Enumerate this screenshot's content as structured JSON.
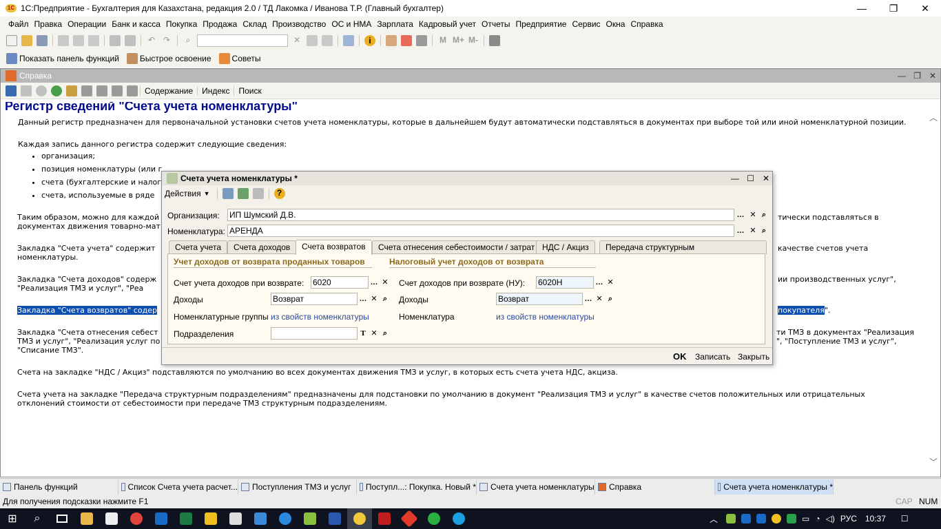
{
  "app": {
    "title": "1С:Предприятие - Бухгалтерия для Казахстана, редакция 2.0 / ТД Лакомка / Иванова Т.Р. (Главный бухгалтер)"
  },
  "menu": [
    "Файл",
    "Правка",
    "Операции",
    "Банк и касса",
    "Покупка",
    "Продажа",
    "Склад",
    "Производство",
    "ОС и НМА",
    "Зарплата",
    "Кадровый учет",
    "Отчеты",
    "Предприятие",
    "Сервис",
    "Окна",
    "Справка"
  ],
  "toolbar3": {
    "show_panel": "Показать панель функций",
    "quick": "Быстрое освоение",
    "tips": "Советы"
  },
  "help": {
    "window_title": "Справка",
    "links": [
      "Содержание",
      "Индекс",
      "Поиск"
    ],
    "heading": "Регистр сведений \"Счета учета номенклатуры\"",
    "p1": "Данный регистр предназначен для первоначальной установки счетов учета номенклатуры, которые в дальнейшем будут автоматически подставляться в документах при выборе той или иной номенклатурной позиции.",
    "p2": "Каждая запись данного регистра содержит следующие сведения:",
    "li": [
      "организация;",
      "позиция номенклатуры (или г",
      "счета (бухгалтерские и налог",
      "счета, используемые в ряде"
    ],
    "p3a": "Таким образом, можно для каждой",
    "p3b": "документах движения товарно-мат",
    "p3c": "тически подставляться в",
    "p4a": "Закладка \"Счета учета\" содержит",
    "p4b": "номенклатуры.",
    "p4c": "качестве счетов учета",
    "p5a": "Закладка \"Счета доходов\" содерж",
    "p5b": "\"Реализация ТМЗ и услуг\", \"Реа",
    "p5c": "ии производственных услуг\",",
    "p6a": "Закладка \"Счета возвратов\" содер",
    "p6b": "покупателя",
    "p6c": "\".",
    "p7a": "Закладка \"Счета отнесения себест",
    "p7b": "ТМЗ и услуг\", \"Реализация услуг по",
    "p7c": "\"Списание ТМЗ\".",
    "p7d": "ти ТМЗ в документах \"Реализация",
    "p7e": "\", \"Поступление ТМЗ и услуг\",",
    "p8": "Счета на закладке \"НДС / Акциз\" подставляются по умолчанию во всех документах движения ТМЗ и услуг, в которых есть счета учета НДС, акциза.",
    "p9a": "Счета учета на закладке \"Передача структурным подразделениям\" предназначены для подстановки по умолчанию в документ \"Реализация ТМЗ и услуг\" в качестве счетов положительных или отрицательных",
    "p9b": "отклонений стоимости от себестоимости при передаче ТМЗ структурным подразделениям."
  },
  "dialog": {
    "title": "Счета учета номенклатуры *",
    "actions": "Действия",
    "org_label": "Организация:",
    "org_value": "ИП Шумский Д.В.",
    "nom_label": "Номенклатура:",
    "nom_value": "АРЕНДА",
    "tabs": [
      "Счета учета",
      "Счета доходов",
      "Счета возвратов",
      "Счета отнесения себестоимости / затрат",
      "НДС / Акциз",
      "Передача структурным подразделениям"
    ],
    "grp1": "Учет доходов от возврата проданных товаров",
    "grp2": "Налоговый учет доходов от возврата",
    "l_acc": "Счет учета доходов при возврате:",
    "v_acc": "6020",
    "l_inc": "Доходы",
    "v_inc": "Возврат",
    "l_ng": "Номенклатурные группы",
    "link1": "из свойств номенклатуры",
    "l_div": "Подразделения",
    "v_div": "",
    "r_acc": "Счет доходов при возврате (НУ):",
    "rv_acc": "6020Н",
    "r_inc": "Доходы",
    "rv_inc": "Возврат",
    "r_nom": "Номенклатура",
    "link2": "из свойств номенклатуры",
    "ok": "OK",
    "save": "Записать",
    "close": "Закрыть"
  },
  "taskbar": [
    "Панель функций",
    "Список Счета учета расчет...",
    "Поступления ТМЗ и услуг",
    "Поступл...: Покупка. Новый *",
    "Счета учета номенклатуры",
    "Справка",
    "Счета учета номенклатуры *"
  ],
  "status": {
    "hint": "Для получения подсказки нажмите F1",
    "cap": "CAP",
    "num": "NUM"
  },
  "tray": {
    "lang": "РУС",
    "time": "10:37"
  }
}
